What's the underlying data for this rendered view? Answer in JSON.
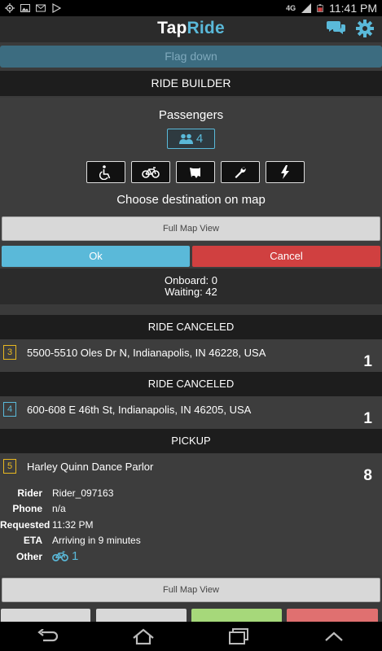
{
  "status_bar": {
    "network": "4G",
    "time": "11:41 PM",
    "icons": [
      "gps-icon",
      "image-icon",
      "gmail-icon",
      "play-store-icon",
      "signal-icon",
      "battery-icon"
    ]
  },
  "app": {
    "brand_part1": "Tap",
    "brand_part2": "Ride",
    "icons": [
      "chat-icon",
      "gear-icon"
    ]
  },
  "flag_down_label": "Flag down",
  "ride_builder": {
    "header": "RIDE BUILDER",
    "passengers_label": "Passengers",
    "passenger_count": "4",
    "options": [
      "wheelchair-icon",
      "bicycle-icon",
      "service-animal-icon",
      "wrench-icon",
      "lightning-icon"
    ],
    "choose_label": "Choose destination on map",
    "full_map_label": "Full Map View",
    "ok_label": "Ok",
    "cancel_label": "Cancel"
  },
  "counts": {
    "onboard": "Onboard: 0",
    "waiting": "Waiting: 42"
  },
  "rides": [
    {
      "status": "RIDE CANCELED",
      "badge": "3",
      "address": "5500-5510 Oles Dr N, Indianapolis, IN 46228, USA",
      "count": "1",
      "badge_color": "#e8b820"
    },
    {
      "status": "RIDE CANCELED",
      "badge": "4",
      "address": "600-608 E 46th St, Indianapolis, IN 46205, USA",
      "count": "1",
      "badge_color": "#5ab9d9"
    },
    {
      "status": "PICKUP",
      "badge": "5",
      "address": "Harley Quinn Dance Parlor",
      "count": "8",
      "badge_color": "#e8b820"
    }
  ],
  "pickup_details": {
    "rider_label": "Rider",
    "rider": "Rider_097163",
    "phone_label": "Phone",
    "phone": "n/a",
    "requested_label": "Requested",
    "requested": "11:32 PM",
    "eta_label": "ETA",
    "eta": "Arriving in 9 minutes",
    "other_label": "Other",
    "other_count": "1"
  },
  "bottom": {
    "full_map_label": "Full Map View",
    "button_colors": [
      "#d8d8d8",
      "#d8d8d8",
      "#a6d87a",
      "#e07070"
    ]
  },
  "colors": {
    "accent": "#5ab9d9",
    "danger": "#d04040",
    "badge_yellow": "#e8b820"
  }
}
